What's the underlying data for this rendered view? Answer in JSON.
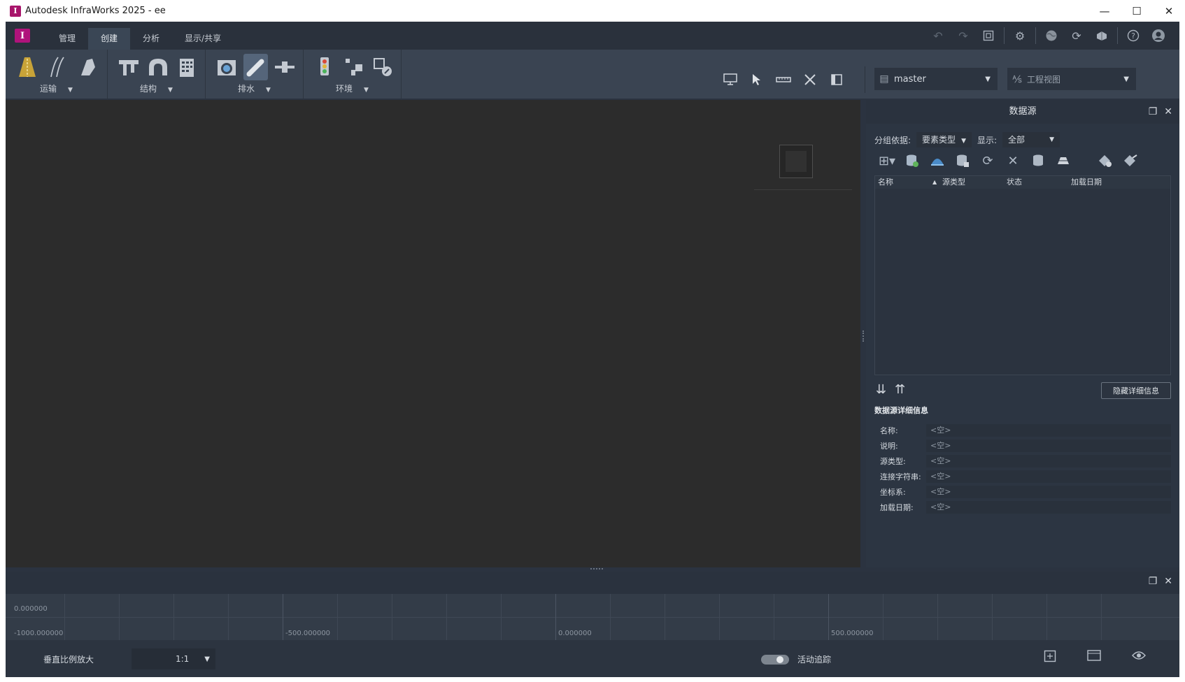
{
  "window": {
    "title": "Autodesk InfraWorks 2025 - ee",
    "app_icon": "I",
    "controls": {
      "minimize": "—",
      "maximize": "☐",
      "close": "✕"
    }
  },
  "menubar": {
    "logo": "I",
    "tabs": [
      {
        "label": "管理"
      },
      {
        "label": "创建"
      },
      {
        "label": "分析"
      },
      {
        "label": "显示/共享"
      }
    ],
    "active_tab": "创建",
    "icons": [
      "undo-icon",
      "redo-icon",
      "fit-view-icon",
      "settings-gear-icon",
      "globe-icon",
      "sync-icon",
      "cloud-model-icon",
      "help-icon",
      "user-avatar-icon"
    ]
  },
  "ribbon": {
    "groups": [
      {
        "label": "运输",
        "icons": [
          "road-icon",
          "railway-icon",
          "pavement-icon"
        ]
      },
      {
        "label": "结构",
        "icons": [
          "bridge-icon",
          "tunnel-icon",
          "building-icon"
        ]
      },
      {
        "label": "排水",
        "icons": [
          "culvert-icon",
          "pipe-icon",
          "pipe-connector-icon"
        ]
      },
      {
        "label": "环境",
        "icons": [
          "traffic-light-icon",
          "tree-icon",
          "city-furniture-icon"
        ]
      }
    ],
    "view_tools": [
      "presentation-icon",
      "select-icon",
      "measure-icon",
      "trim-icon",
      "panel-icon"
    ],
    "branch": {
      "icon": "branch-icon",
      "value": "master"
    },
    "view": {
      "icon": "view-icon",
      "value": "工程视图"
    }
  },
  "datasource": {
    "title": "数据源",
    "group_by_label": "分组依据:",
    "group_by_value": "要素类型",
    "show_label": "显示:",
    "show_value": "全部",
    "toolbar": [
      "add-source-icon",
      "database-add-icon",
      "online-source-icon",
      "database-config-icon",
      "refresh-icon",
      "remove-icon",
      "database-icon",
      "layers-icon",
      "shape-add-icon",
      "shape-edit-icon"
    ],
    "columns": [
      "名称",
      "源类型",
      "状态",
      "加载日期"
    ],
    "hide_details_button": "隐藏详细信息",
    "details_title": "数据源详细信息",
    "details": [
      {
        "label": "名称:",
        "value": "<空>"
      },
      {
        "label": "说明:",
        "value": "<空>"
      },
      {
        "label": "源类型:",
        "value": "<空>"
      },
      {
        "label": "连接字符串:",
        "value": "<空>"
      },
      {
        "label": "坐标系:",
        "value": "<空>"
      },
      {
        "label": "加载日期:",
        "value": "<空>"
      }
    ]
  },
  "profile": {
    "y_label": "0.000000",
    "x_labels": [
      "-1000.000000",
      "-500.000000",
      "0.000000",
      "500.000000"
    ]
  },
  "footer": {
    "vertical_scale_label": "垂直比例放大",
    "vertical_scale_value": "1:1",
    "tracking_label": "活动追踪",
    "tracking_on": true
  }
}
